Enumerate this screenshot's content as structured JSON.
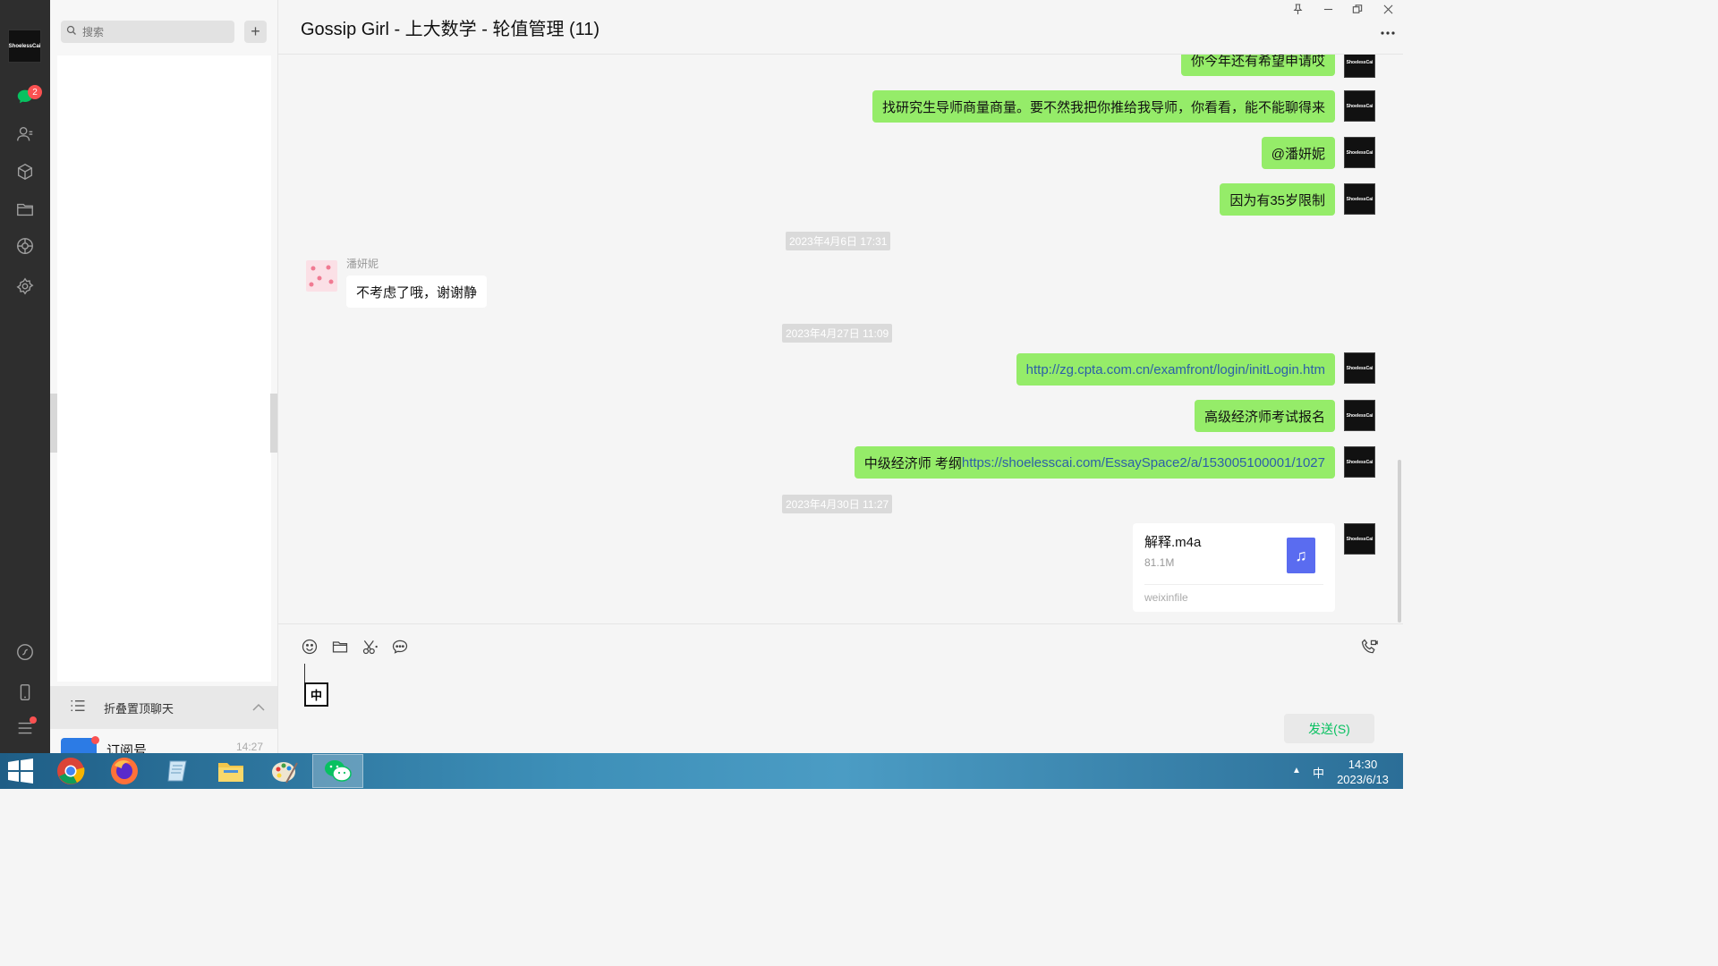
{
  "nav": {
    "avatar_text": "ShoelessCai",
    "chat_badge": "2",
    "icons": [
      "chat-icon",
      "contacts-icon",
      "favorites-icon",
      "files-icon",
      "moments-icon",
      "mini-programs-icon",
      "channels-icon",
      "phone-icon",
      "menu-icon"
    ]
  },
  "chatlist": {
    "search_placeholder": "搜索",
    "add_label": "+",
    "folded_label": "折叠置顶聊天",
    "subscription": {
      "name": "订阅号",
      "time": "14:27"
    }
  },
  "chat": {
    "title": "Gossip Girl - 上大数学 - 轮值管理 (11)",
    "messages": [
      {
        "from": "me",
        "text": "你今年还有希望申请哎"
      },
      {
        "from": "me",
        "text": "找研究生导师商量商量。要不然我把你推给我导师，你看看，能不能聊得来"
      },
      {
        "from": "me",
        "text": "@潘妍妮"
      },
      {
        "from": "me",
        "text": "因为有35岁限制"
      },
      {
        "type": "time",
        "text": "2023年4月6日 17:31"
      },
      {
        "from": "other",
        "sender": "潘妍妮",
        "text": "不考虑了哦，谢谢静"
      },
      {
        "type": "time",
        "text": "2023年4月27日 11:09"
      },
      {
        "from": "me",
        "link": "http://zg.cpta.com.cn/examfront/login/initLogin.htm"
      },
      {
        "from": "me",
        "text": "高级经济师考试报名"
      },
      {
        "from": "me",
        "text": "中级经济师 考纲 ",
        "link": "https://shoelesscai.com/EssaySpace2/a/153005100001/1027"
      },
      {
        "type": "time",
        "text": "2023年4月30日 11:27"
      },
      {
        "from": "me",
        "type": "file",
        "file_name": "解释.m4a",
        "file_size": "81.1M",
        "file_source": "weixinfile"
      }
    ]
  },
  "input": {
    "ime_label": "中",
    "send_label": "发送(S)"
  },
  "taskbar": {
    "apps": [
      "chrome",
      "firefox",
      "notepad",
      "file-explorer",
      "paint",
      "wechat"
    ],
    "ime": "中",
    "time": "14:30",
    "date": "2023/6/13"
  },
  "colors": {
    "nav_bg": "#2e2e2e",
    "my_bubble": "#95ec69",
    "other_bubble": "#ffffff",
    "accent": "#07c160",
    "badge": "#fa5151",
    "link": "#2d5fa8"
  }
}
